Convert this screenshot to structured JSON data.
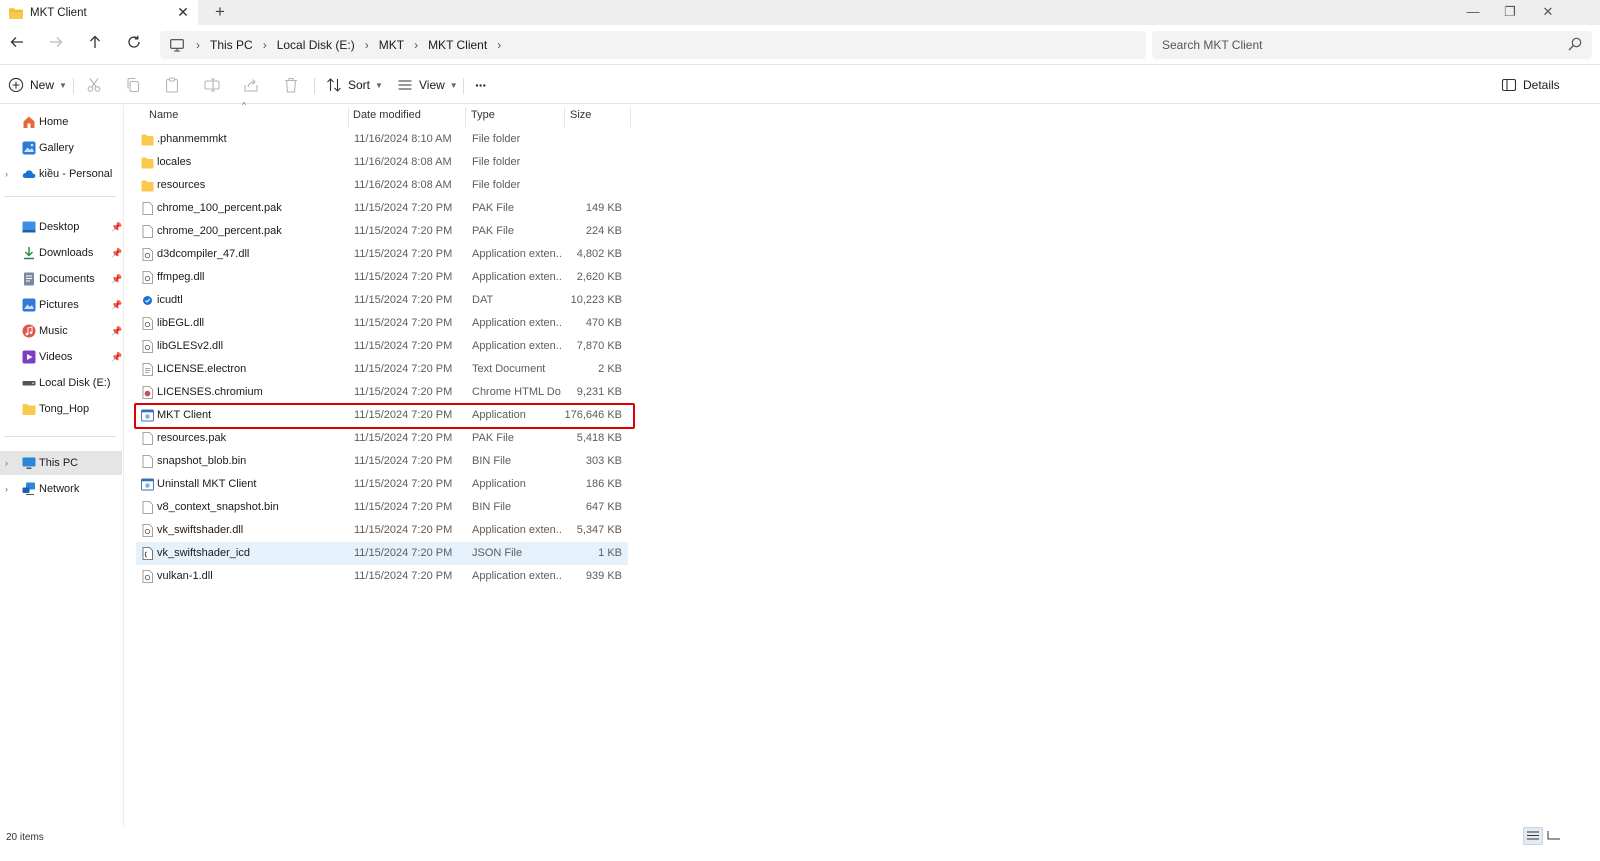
{
  "window": {
    "tab_title": "MKT Client",
    "new_tab": "+",
    "close_tab": "✕",
    "minimize": "—",
    "restore": "❐",
    "close": "✕"
  },
  "address": {
    "crumbs": [
      "This PC",
      "Local Disk (E:)",
      "MKT",
      "MKT Client"
    ],
    "search_placeholder": "Search MKT Client"
  },
  "command_bar": {
    "new_label": "New",
    "sort_label": "Sort",
    "view_label": "View",
    "more_label": "···",
    "details_label": "Details"
  },
  "sidebar": {
    "items": [
      {
        "label": "Home"
      },
      {
        "label": "Gallery"
      },
      {
        "label": "kiều - Personal"
      },
      {
        "label": "Desktop"
      },
      {
        "label": "Downloads"
      },
      {
        "label": "Documents"
      },
      {
        "label": "Pictures"
      },
      {
        "label": "Music"
      },
      {
        "label": "Videos"
      },
      {
        "label": "Local Disk (E:)"
      },
      {
        "label": "Tong_Hop"
      },
      {
        "label": "This PC"
      },
      {
        "label": "Network"
      }
    ]
  },
  "columns": {
    "name": "Name",
    "date": "Date modified",
    "type": "Type",
    "size": "Size"
  },
  "files": [
    {
      "name": ".phanmemmkt",
      "date": "11/16/2024 8:10 AM",
      "type": "File folder",
      "size": "",
      "icon": "folder-icon"
    },
    {
      "name": "locales",
      "date": "11/16/2024 8:08 AM",
      "type": "File folder",
      "size": "",
      "icon": "folder-icon"
    },
    {
      "name": "resources",
      "date": "11/16/2024 8:08 AM",
      "type": "File folder",
      "size": "",
      "icon": "folder-icon"
    },
    {
      "name": "chrome_100_percent.pak",
      "date": "11/15/2024 7:20 PM",
      "type": "PAK File",
      "size": "149 KB",
      "icon": "file-icon"
    },
    {
      "name": "chrome_200_percent.pak",
      "date": "11/15/2024 7:20 PM",
      "type": "PAK File",
      "size": "224 KB",
      "icon": "file-icon"
    },
    {
      "name": "d3dcompiler_47.dll",
      "date": "11/15/2024 7:20 PM",
      "type": "Application exten...",
      "size": "4,802 KB",
      "icon": "dll-icon"
    },
    {
      "name": "ffmpeg.dll",
      "date": "11/15/2024 7:20 PM",
      "type": "Application exten...",
      "size": "2,620 KB",
      "icon": "dll-icon"
    },
    {
      "name": "icudtl",
      "date": "11/15/2024 7:20 PM",
      "type": "DAT",
      "size": "10,223 KB",
      "icon": "dat-icon"
    },
    {
      "name": "libEGL.dll",
      "date": "11/15/2024 7:20 PM",
      "type": "Application exten...",
      "size": "470 KB",
      "icon": "dll-icon"
    },
    {
      "name": "libGLESv2.dll",
      "date": "11/15/2024 7:20 PM",
      "type": "Application exten...",
      "size": "7,870 KB",
      "icon": "dll-icon"
    },
    {
      "name": "LICENSE.electron",
      "date": "11/15/2024 7:20 PM",
      "type": "Text Document",
      "size": "2 KB",
      "icon": "text-file-icon"
    },
    {
      "name": "LICENSES.chromium",
      "date": "11/15/2024 7:20 PM",
      "type": "Chrome HTML Do...",
      "size": "9,231 KB",
      "icon": "chrome-html-icon"
    },
    {
      "name": "MKT Client",
      "date": "11/15/2024 7:20 PM",
      "type": "Application",
      "size": "176,646 KB",
      "icon": "app-icon"
    },
    {
      "name": "resources.pak",
      "date": "11/15/2024 7:20 PM",
      "type": "PAK File",
      "size": "5,418 KB",
      "icon": "file-icon"
    },
    {
      "name": "snapshot_blob.bin",
      "date": "11/15/2024 7:20 PM",
      "type": "BIN File",
      "size": "303 KB",
      "icon": "file-icon"
    },
    {
      "name": "Uninstall MKT Client",
      "date": "11/15/2024 7:20 PM",
      "type": "Application",
      "size": "186 KB",
      "icon": "app-icon"
    },
    {
      "name": "v8_context_snapshot.bin",
      "date": "11/15/2024 7:20 PM",
      "type": "BIN File",
      "size": "647 KB",
      "icon": "file-icon"
    },
    {
      "name": "vk_swiftshader.dll",
      "date": "11/15/2024 7:20 PM",
      "type": "Application exten...",
      "size": "5,347 KB",
      "icon": "dll-icon"
    },
    {
      "name": "vk_swiftshader_icd",
      "date": "11/15/2024 7:20 PM",
      "type": "JSON File",
      "size": "1 KB",
      "icon": "json-file-icon"
    },
    {
      "name": "vulkan-1.dll",
      "date": "11/15/2024 7:20 PM",
      "type": "Application exten...",
      "size": "939 KB",
      "icon": "dll-icon"
    }
  ],
  "highlighted_file": "MKT Client",
  "hovered_file": "vk_swiftshader_icd",
  "status": {
    "item_count": "20 items"
  },
  "colors": {
    "folder": "#f8c94c",
    "highlight_border": "#e00000",
    "hover_row": "#e5f1fb",
    "selected_nav": "#e5e5e5"
  }
}
